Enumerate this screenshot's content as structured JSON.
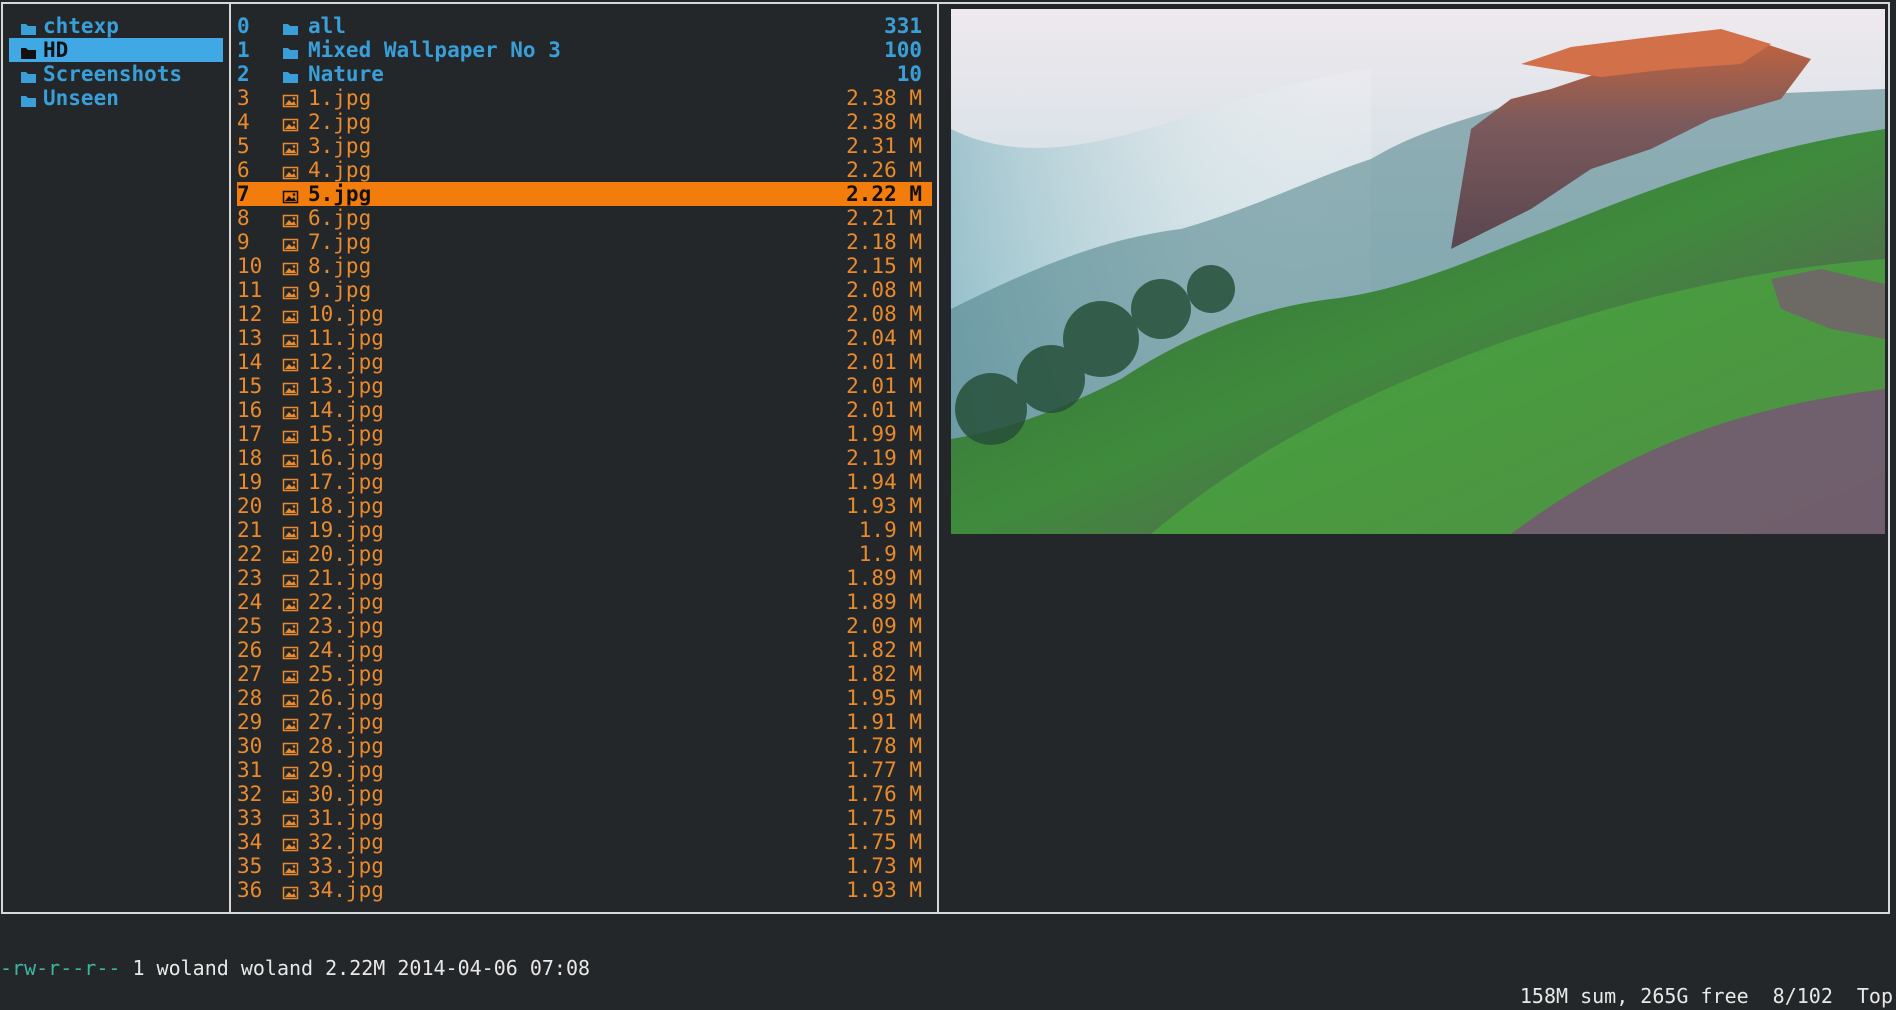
{
  "colors": {
    "background": "#232729",
    "directory": "#3a9fd9",
    "image_file": "#e98a2c",
    "selected_dir": "#3fa8e5",
    "selected_file": "#f27c0c",
    "permissions": "#3cb6a0"
  },
  "parent": {
    "items": [
      {
        "label": "chtexp",
        "icon": "folder-icon",
        "selected": false
      },
      {
        "label": "HD",
        "icon": "folder-icon",
        "selected": true
      },
      {
        "label": "Screenshots",
        "icon": "folder-icon",
        "selected": false
      },
      {
        "label": "Unseen",
        "icon": "folder-icon",
        "selected": false
      }
    ]
  },
  "files": [
    {
      "num": "0",
      "name": "all",
      "size": "331",
      "type": "dir"
    },
    {
      "num": "1",
      "name": "Mixed Wallpaper No 3",
      "size": "100",
      "type": "dir"
    },
    {
      "num": "2",
      "name": "Nature",
      "size": "10",
      "type": "dir"
    },
    {
      "num": "3",
      "name": "1.jpg",
      "size": "2.38 M",
      "type": "img"
    },
    {
      "num": "4",
      "name": "2.jpg",
      "size": "2.38 M",
      "type": "img"
    },
    {
      "num": "5",
      "name": "3.jpg",
      "size": "2.31 M",
      "type": "img"
    },
    {
      "num": "6",
      "name": "4.jpg",
      "size": "2.26 M",
      "type": "img"
    },
    {
      "num": "7",
      "name": "5.jpg",
      "size": "2.22 M",
      "type": "img",
      "selected": true
    },
    {
      "num": "8",
      "name": "6.jpg",
      "size": "2.21 M",
      "type": "img"
    },
    {
      "num": "9",
      "name": "7.jpg",
      "size": "2.18 M",
      "type": "img"
    },
    {
      "num": "10",
      "name": "8.jpg",
      "size": "2.15 M",
      "type": "img"
    },
    {
      "num": "11",
      "name": "9.jpg",
      "size": "2.08 M",
      "type": "img"
    },
    {
      "num": "12",
      "name": "10.jpg",
      "size": "2.08 M",
      "type": "img"
    },
    {
      "num": "13",
      "name": "11.jpg",
      "size": "2.04 M",
      "type": "img"
    },
    {
      "num": "14",
      "name": "12.jpg",
      "size": "2.01 M",
      "type": "img"
    },
    {
      "num": "15",
      "name": "13.jpg",
      "size": "2.01 M",
      "type": "img"
    },
    {
      "num": "16",
      "name": "14.jpg",
      "size": "2.01 M",
      "type": "img"
    },
    {
      "num": "17",
      "name": "15.jpg",
      "size": "1.99 M",
      "type": "img"
    },
    {
      "num": "18",
      "name": "16.jpg",
      "size": "2.19 M",
      "type": "img"
    },
    {
      "num": "19",
      "name": "17.jpg",
      "size": "1.94 M",
      "type": "img"
    },
    {
      "num": "20",
      "name": "18.jpg",
      "size": "1.93 M",
      "type": "img"
    },
    {
      "num": "21",
      "name": "19.jpg",
      "size": "1.9 M",
      "type": "img"
    },
    {
      "num": "22",
      "name": "20.jpg",
      "size": "1.9 M",
      "type": "img"
    },
    {
      "num": "23",
      "name": "21.jpg",
      "size": "1.89 M",
      "type": "img"
    },
    {
      "num": "24",
      "name": "22.jpg",
      "size": "1.89 M",
      "type": "img"
    },
    {
      "num": "25",
      "name": "23.jpg",
      "size": "2.09 M",
      "type": "img"
    },
    {
      "num": "26",
      "name": "24.jpg",
      "size": "1.82 M",
      "type": "img"
    },
    {
      "num": "27",
      "name": "25.jpg",
      "size": "1.82 M",
      "type": "img"
    },
    {
      "num": "28",
      "name": "26.jpg",
      "size": "1.95 M",
      "type": "img"
    },
    {
      "num": "29",
      "name": "27.jpg",
      "size": "1.91 M",
      "type": "img"
    },
    {
      "num": "30",
      "name": "28.jpg",
      "size": "1.78 M",
      "type": "img"
    },
    {
      "num": "31",
      "name": "29.jpg",
      "size": "1.77 M",
      "type": "img"
    },
    {
      "num": "32",
      "name": "30.jpg",
      "size": "1.76 M",
      "type": "img"
    },
    {
      "num": "33",
      "name": "31.jpg",
      "size": "1.75 M",
      "type": "img"
    },
    {
      "num": "34",
      "name": "32.jpg",
      "size": "1.75 M",
      "type": "img"
    },
    {
      "num": "35",
      "name": "33.jpg",
      "size": "1.73 M",
      "type": "img"
    },
    {
      "num": "36",
      "name": "34.jpg",
      "size": "1.93 M",
      "type": "img"
    }
  ],
  "status": {
    "permissions": "-rw-r--r--",
    "info": " 1 woland woland 2.22M 2014-04-06 07:08",
    "summary": "158M sum, 265G free",
    "position": "8/102",
    "scroll": "Top"
  }
}
